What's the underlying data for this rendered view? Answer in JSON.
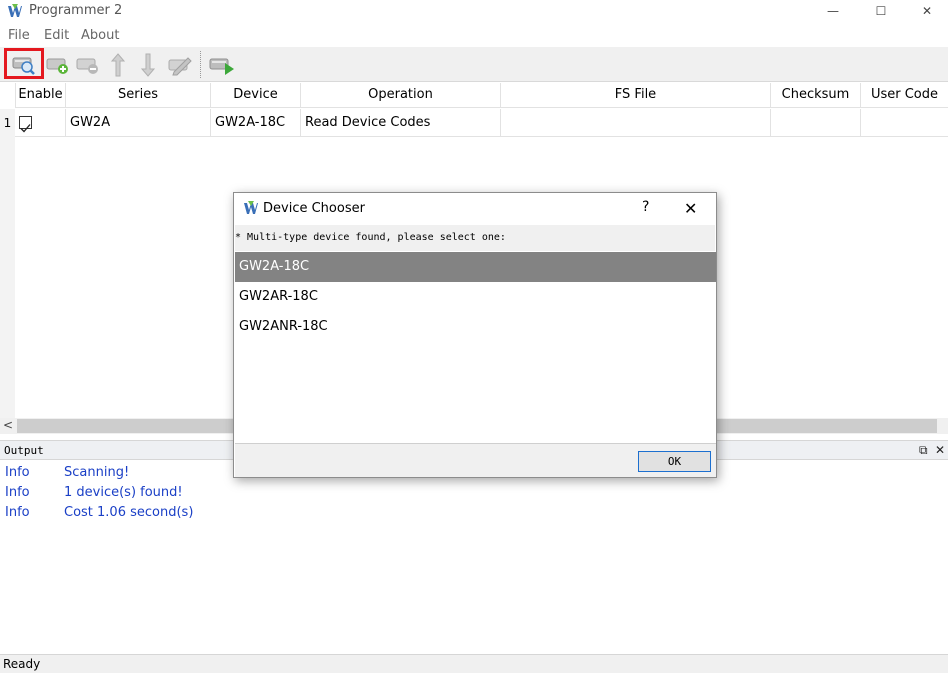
{
  "window": {
    "title": "Programmer 2",
    "controls": {
      "minimize": "—",
      "maximize": "☐",
      "close": "✕"
    }
  },
  "menu": {
    "items": [
      "File",
      "Edit",
      "About"
    ]
  },
  "toolbar": {
    "buttons": [
      "scan-device-icon",
      "add-device-icon",
      "remove-device-icon",
      "move-up-icon",
      "move-down-icon",
      "edit-device-icon",
      "program-run-icon"
    ],
    "highlight_color": "#e4181f"
  },
  "table": {
    "columns": [
      "Enable",
      "Series",
      "Device",
      "Operation",
      "FS File",
      "Checksum",
      "User Code"
    ],
    "rows": [
      {
        "num": "1",
        "enabled": true,
        "series": "GW2A",
        "device": "GW2A-18C",
        "operation": "Read Device Codes",
        "fs_file": "",
        "checksum": "",
        "user_code": ""
      }
    ]
  },
  "output": {
    "title": "Output",
    "log": [
      {
        "level": "Info",
        "message": "Scanning!"
      },
      {
        "level": "Info",
        "message": "1 device(s) found!"
      },
      {
        "level": "Info",
        "message": "Cost 1.06 second(s)"
      }
    ],
    "log_color": "#1a3fc6"
  },
  "status": {
    "text": "Ready"
  },
  "dialog": {
    "title": "Device Chooser",
    "help": "?",
    "close": "✕",
    "prompt": "* Multi-type device found, please select one:",
    "options": [
      "GW2A-18C",
      "GW2AR-18C",
      "GW2ANR-18C"
    ],
    "selected": "GW2A-18C",
    "ok_label": "OK",
    "selected_color": "#838383"
  }
}
